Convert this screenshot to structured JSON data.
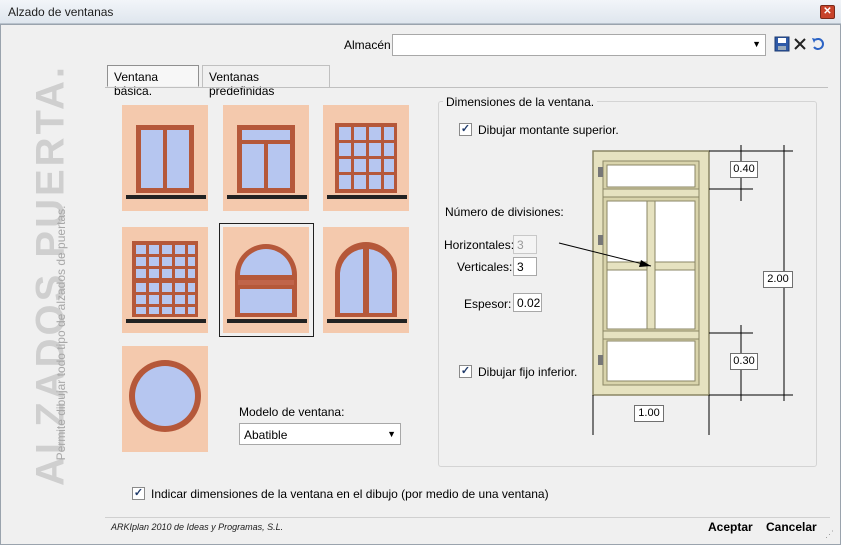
{
  "window": {
    "title": "Alzado de ventanas"
  },
  "sidebar": {
    "big_text": "ALZADOS PUERTA.",
    "sub_text": "Permite dibujar todo tipo de alzados de puertas."
  },
  "almacen": {
    "label": "Almacén",
    "value": ""
  },
  "toolbar": {
    "save_icon": "save-icon",
    "delete_icon": "delete-icon",
    "undo_icon": "undo-icon"
  },
  "tabs": [
    {
      "label": "Ventana básica.",
      "active": true
    },
    {
      "label": "Ventanas predefinidas",
      "active": false
    }
  ],
  "thumbnails": [
    {
      "name": "two-pane-casement"
    },
    {
      "name": "two-pane-with-transom"
    },
    {
      "name": "grid-16-panes"
    },
    {
      "name": "sash-grid-window"
    },
    {
      "name": "arched-with-transom",
      "selected": true
    },
    {
      "name": "arched-two-pane"
    },
    {
      "name": "round-window"
    }
  ],
  "modelo": {
    "label": "Modelo de ventana:",
    "value": "Abatible"
  },
  "dimensions_panel": {
    "title": "Dimensiones de la ventana.",
    "montante_label": "Dibujar montante superior.",
    "montante_checked": true,
    "divisiones_label": "Número de divisiones:",
    "horizontales_label": "Horizontales:",
    "horizontales_value": "3",
    "verticales_label": "Verticales:",
    "verticales_value": "3",
    "espesor_label": "Espesor:",
    "espesor_value": "0.02",
    "fijo_label": "Dibujar fijo inferior.",
    "fijo_checked": true,
    "dim_top": "0.40",
    "dim_height": "2.00",
    "dim_bottom": "0.30",
    "dim_width": "1.00"
  },
  "indicar": {
    "label": "Indicar dimensiones de la ventana en el dibujo (por medio de una ventana)",
    "checked": true
  },
  "footer": {
    "copyright": "ARKIplan 2010 de Ideas y Programas, S.L.",
    "accept_label": "Aceptar",
    "cancel_label": "Cancelar"
  }
}
